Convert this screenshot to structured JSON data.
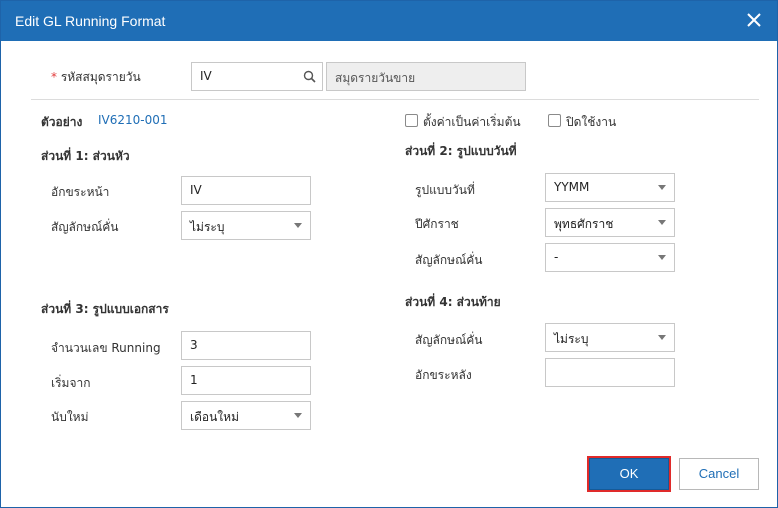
{
  "dialog": {
    "title": "Edit GL Running Format"
  },
  "journal": {
    "required_mark": "*",
    "label": "รหัสสมุดรายวัน",
    "code_value": "IV",
    "name_value": "สมุดรายวันขาย"
  },
  "example": {
    "label": "ตัวอย่าง",
    "value": "IV6210-001"
  },
  "options": {
    "set_default_label": "ตั้งค่าเป็นค่าเริ่มต้น",
    "disable_label": "ปิดใช้งาน"
  },
  "section1": {
    "title": "ส่วนที่ 1: ส่วนหัว",
    "prefix_label": "อักขระหน้า",
    "prefix_value": "IV",
    "separator_label": "สัญลักษณ์คั่น",
    "separator_value": "ไม่ระบุ"
  },
  "section2": {
    "title": "ส่วนที่ 2: รูปแบบวันที่",
    "date_format_label": "รูปแบบวันที่",
    "date_format_value": "YYMM",
    "era_label": "ปีศักราช",
    "era_value": "พุทธศักราช",
    "separator_label": "สัญลักษณ์คั่น",
    "separator_value": "-"
  },
  "section3": {
    "title": "ส่วนที่ 3: รูปแบบเอกสาร",
    "running_digits_label": "จำนวนเลข Running",
    "running_digits_value": "3",
    "start_from_label": "เริ่มจาก",
    "start_from_value": "1",
    "reset_label": "นับใหม่",
    "reset_value": "เดือนใหม่"
  },
  "section4": {
    "title": "ส่วนที่ 4: ส่วนท้าย",
    "separator_label": "สัญลักษณ์คั่น",
    "separator_value": "ไม่ระบุ",
    "suffix_label": "อักขระหลัง",
    "suffix_value": ""
  },
  "buttons": {
    "ok_label": "OK",
    "cancel_label": "Cancel"
  },
  "colors": {
    "header_bg": "#1f6eb6",
    "ok_highlight": "#e02a2a"
  }
}
